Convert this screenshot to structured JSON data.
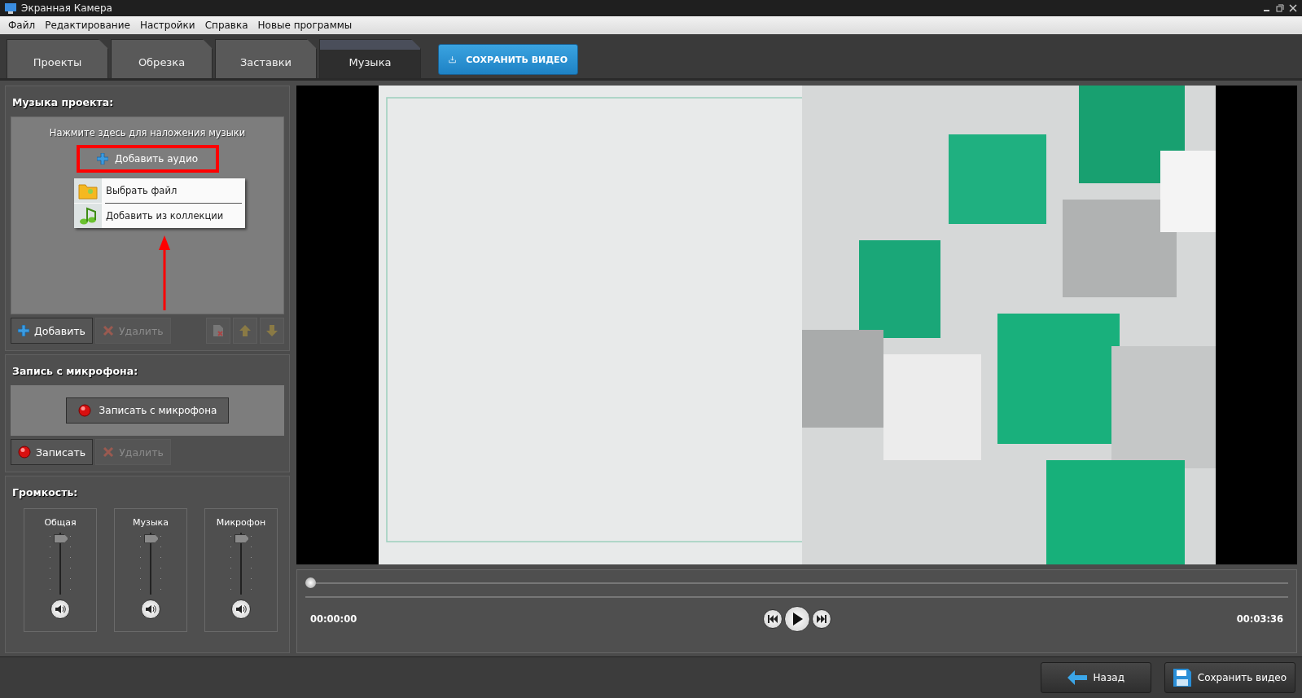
{
  "window": {
    "title": "Экранная Камера"
  },
  "menu": [
    "Файл",
    "Редактирование",
    "Настройки",
    "Справка",
    "Новые программы"
  ],
  "tabs": [
    {
      "label": "Проекты",
      "selected": false
    },
    {
      "label": "Обрезка",
      "selected": false
    },
    {
      "label": "Заставки",
      "selected": false
    },
    {
      "label": "Музыка",
      "selected": true
    }
  ],
  "save_top": "СОХРАНИТЬ ВИДЕО",
  "music": {
    "title": "Музыка проекта:",
    "hint": "Нажмите здесь для наложения музыки",
    "add_audio": "Добавить аудио",
    "dropdown": [
      {
        "kind": "folder",
        "label": "Выбрать файл"
      },
      {
        "kind": "note",
        "label": "Добавить из коллекции"
      }
    ],
    "add": {
      "label": "Добавить",
      "disabled": false
    },
    "delete": {
      "label": "Удалить",
      "disabled": true
    }
  },
  "mic": {
    "title": "Запись с микрофона:",
    "record_mic": "Записать с микрофона",
    "record": {
      "label": "Записать",
      "disabled": false
    },
    "delete": {
      "label": "Удалить",
      "disabled": true
    }
  },
  "volume": {
    "title": "Громкость:",
    "channels": [
      {
        "name": "Общая",
        "level": 0.95
      },
      {
        "name": "Музыка",
        "level": 0.95
      },
      {
        "name": "Микрофон",
        "level": 0.95
      }
    ]
  },
  "player": {
    "position": {
      "level": 0
    },
    "time_start": "00:00:00",
    "time_end": "00:03:36"
  },
  "footer": {
    "back": "Назад",
    "save": "Сохранить видео"
  }
}
